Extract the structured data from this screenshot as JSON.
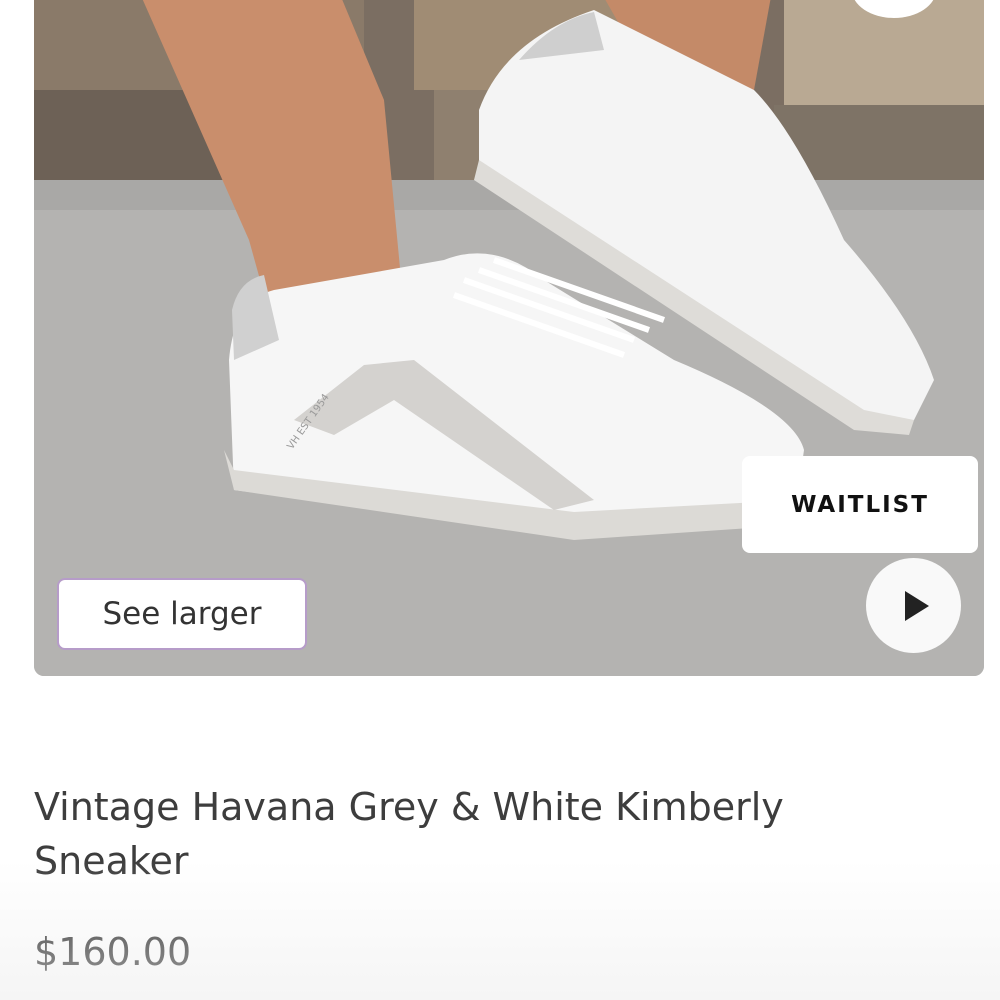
{
  "gallery": {
    "image_alt": "Vintage Havana Grey & White Kimberly Sneaker",
    "sneaker_print": "VH EST 1954",
    "see_larger_label": "See larger",
    "waitlist_label": "WAITLIST",
    "play_icon": "play-icon"
  },
  "product": {
    "title": "Vintage Havana Grey & White Kimberly Sneaker",
    "price": "$160.00"
  }
}
